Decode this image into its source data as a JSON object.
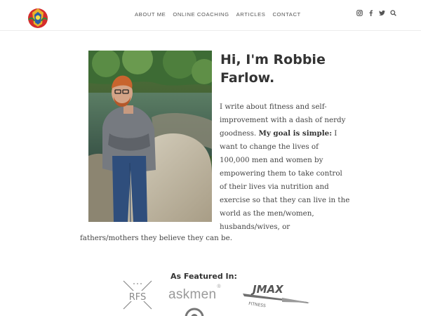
{
  "colors": {
    "text": "#444444",
    "heading": "#333333",
    "nav": "#555555",
    "divider": "#ececec"
  },
  "header": {
    "logo_icon": "crest-logo-icon",
    "nav": [
      {
        "label": "ABOUT ME"
      },
      {
        "label": "ONLINE COACHING"
      },
      {
        "label": "ARTICLES"
      },
      {
        "label": "CONTACT"
      }
    ],
    "social_icons": [
      "instagram-icon",
      "facebook-icon",
      "twitter-icon"
    ],
    "search_icon": "search-icon"
  },
  "hero": {
    "photo": "portrait-photo",
    "title": "Hi, I'm Robbie Farlow.",
    "bio_intro": "I write about fitness and self-improvement with a dash of nerdy goodness.",
    "bio_emphasis": "My goal is simple:",
    "bio_rest": "I want to change the lives of 100,000 men and women by empowering them to take control of their lives via nutrition and exercise so that they can live in the world as the men/women, husbands/wives, or",
    "bio_last_line": "fathers/mothers they believe they can be."
  },
  "featured": {
    "heading": "As Featured In:",
    "logos": {
      "rfs": "RFS",
      "askmen": "askmen",
      "askmen_mark": "®",
      "jmax": "JMAX",
      "jmax_sub": "FITNESS"
    }
  }
}
